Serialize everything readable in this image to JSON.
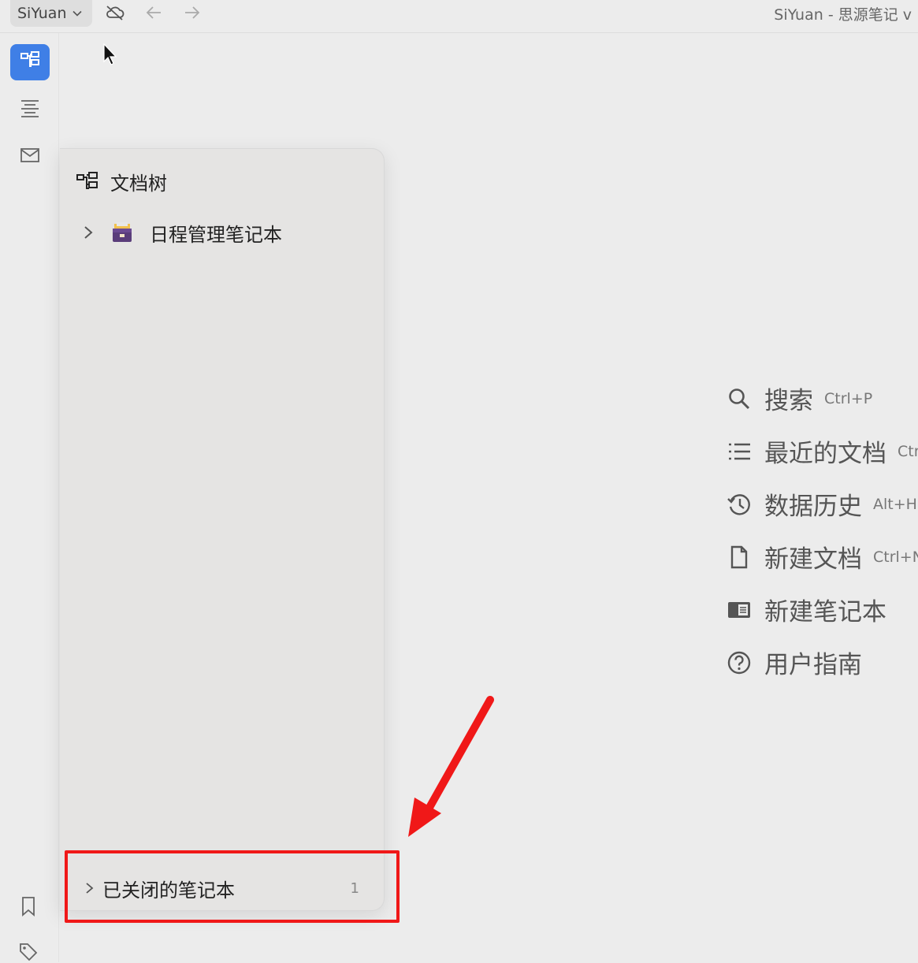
{
  "topbar": {
    "workspace_label": "SiYuan",
    "window_title": "SiYuan - 思源笔记 v"
  },
  "panel": {
    "title": "文档树",
    "notebooks": [
      {
        "label": "日程管理笔记本",
        "icon": "archive-box-icon"
      }
    ],
    "closed": {
      "label": "已关闭的笔记本",
      "count": "1"
    }
  },
  "quick_actions": [
    {
      "icon": "search-icon",
      "label": "搜索",
      "shortcut": "Ctrl+P"
    },
    {
      "icon": "list-icon",
      "label": "最近的文档",
      "shortcut": "Ctr"
    },
    {
      "icon": "history-icon",
      "label": "数据历史",
      "shortcut": "Alt+H"
    },
    {
      "icon": "file-icon",
      "label": "新建文档",
      "shortcut": "Ctrl+N"
    },
    {
      "icon": "notebook-icon",
      "label": "新建笔记本",
      "shortcut": ""
    },
    {
      "icon": "help-icon",
      "label": "用户指南",
      "shortcut": ""
    }
  ],
  "colors": {
    "accent": "#3f7fe6",
    "annotation": "#f01818",
    "background": "#ececec"
  }
}
